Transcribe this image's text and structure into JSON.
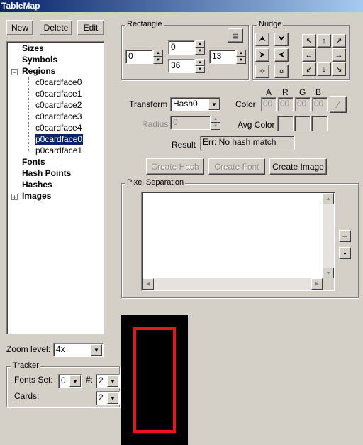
{
  "window": {
    "title": "TableMap"
  },
  "toolbar": {
    "new_label": "New",
    "delete_label": "Delete",
    "edit_label": "Edit"
  },
  "tree": {
    "sizes": "Sizes",
    "symbols": "Symbols",
    "regions": "Regions",
    "region_items": [
      "c0cardface0",
      "c0cardface1",
      "c0cardface2",
      "c0cardface3",
      "c0cardface4",
      "p0cardface0",
      "p0cardface1"
    ],
    "fonts": "Fonts",
    "hash_points": "Hash Points",
    "hashes": "Hashes",
    "images": "Images"
  },
  "rectangle": {
    "label": "Rectangle",
    "left": "0",
    "top": "0",
    "bottom": "36",
    "right": "13"
  },
  "nudge": {
    "label": "Nudge"
  },
  "transform": {
    "label": "Transform",
    "value": "Hash0"
  },
  "radius": {
    "label": "Radius",
    "value": "0"
  },
  "color": {
    "label": "Color",
    "a_header": "A",
    "r_header": "R",
    "g_header": "G",
    "b_header": "B",
    "a": "00",
    "r": "00",
    "g": "00",
    "b": "00"
  },
  "avg_color": {
    "label": "Avg Color"
  },
  "result": {
    "label": "Result",
    "value": "Err: No hash match"
  },
  "actions": {
    "create_hash": "Create Hash",
    "create_font": "Create Font",
    "create_image": "Create Image"
  },
  "pixel_separation": {
    "label": "Pixel Separation",
    "plus": "+",
    "minus": "-"
  },
  "zoom": {
    "label": "Zoom level:",
    "value": "4x"
  },
  "tracker": {
    "label": "Tracker",
    "fonts_set_label": "Fonts Set:",
    "fonts_set_value": "0",
    "hash_label": "#:",
    "hash_value": "2",
    "cards_label": "Cards:",
    "cards_value": "2"
  },
  "colors": {
    "selection": "#0a246a",
    "preview_bg": "#000000",
    "preview_rect": "#e8141e"
  }
}
